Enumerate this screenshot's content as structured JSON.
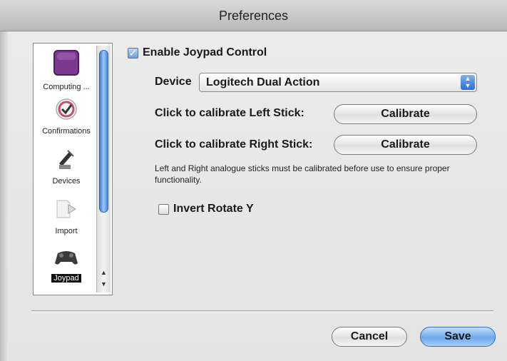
{
  "window": {
    "title": "Preferences"
  },
  "sidebar": {
    "items": [
      {
        "label": "Computing ...",
        "icon": "purple-square-icon"
      },
      {
        "label": "Confirmations",
        "icon": "checkmark-icon"
      },
      {
        "label": "Devices",
        "icon": "device-tool-icon"
      },
      {
        "label": "Import",
        "icon": "import-arrow-icon"
      },
      {
        "label": "Joypad",
        "icon": "gamepad-icon",
        "selected": true
      }
    ]
  },
  "joypad": {
    "enable_label": "Enable Joypad Control",
    "enable_checked": true,
    "device_label": "Device",
    "device_value": "Logitech Dual Action",
    "left_stick_label": "Click to calibrate Left Stick:",
    "right_stick_label": "Click to calibrate Right Stick:",
    "calibrate_label": "Calibrate",
    "note": "Left and Right analogue sticks must be calibrated before use to ensure proper functionality.",
    "invert_label": "Invert Rotate Y",
    "invert_checked": false
  },
  "footer": {
    "cancel_label": "Cancel",
    "save_label": "Save"
  },
  "colors": {
    "accent": "#4a89e0",
    "selected_bg": "#111111",
    "computing_icon": "#7b3a8e"
  }
}
